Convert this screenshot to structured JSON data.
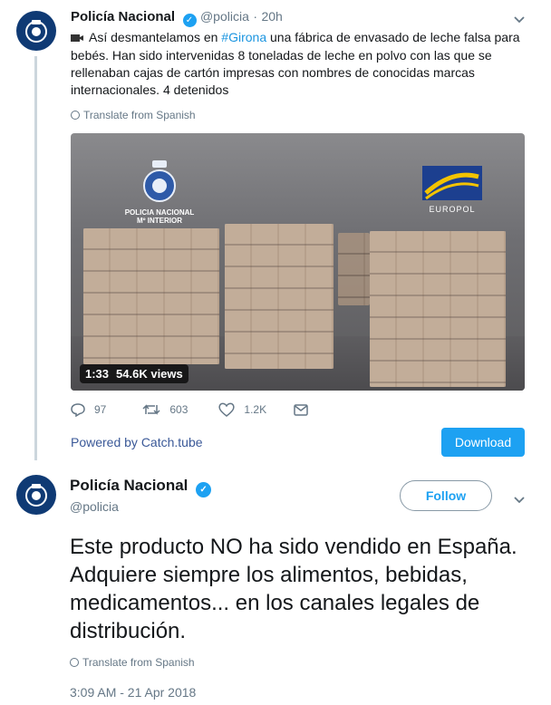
{
  "tweet1": {
    "name": "Policía Nacional",
    "handle": "@policia",
    "separator": "·",
    "time": "20h",
    "text_part1": "Así desmantelamos en ",
    "hashtag": "#Girona",
    "text_part2": " una fábrica de envasado de leche falsa para bebés. Han sido intervenidas 8 toneladas de leche en polvo con las que se rellenaban cajas de cartón impresas con nombres de conocidas marcas internacionales. 4 detenidos",
    "translate": "Translate from Spanish",
    "video": {
      "duration": "1:33",
      "views": "54.6K views",
      "logo_left_line1": "POLICIA NACIONAL",
      "logo_left_line2": "Mº INTERIOR",
      "logo_right": "EUROPOL"
    },
    "actions": {
      "replies": "97",
      "retweets": "603",
      "likes": "1.2K"
    },
    "powered_by": "Powered by Catch.tube",
    "download_label": "Download"
  },
  "tweet2": {
    "name": "Policía Nacional",
    "handle": "@policia",
    "follow_label": "Follow",
    "text": "Este producto NO ha sido vendido en España. Adquiere siempre los alimentos, bebidas, medicamentos... en los canales legales de distribución.",
    "translate": "Translate from Spanish",
    "timestamp": "3:09 AM - 21 Apr 2018"
  },
  "colors": {
    "accent": "#1da1f2",
    "link": "#1b95e0",
    "muted": "#657786",
    "powered": "#3b5998"
  }
}
